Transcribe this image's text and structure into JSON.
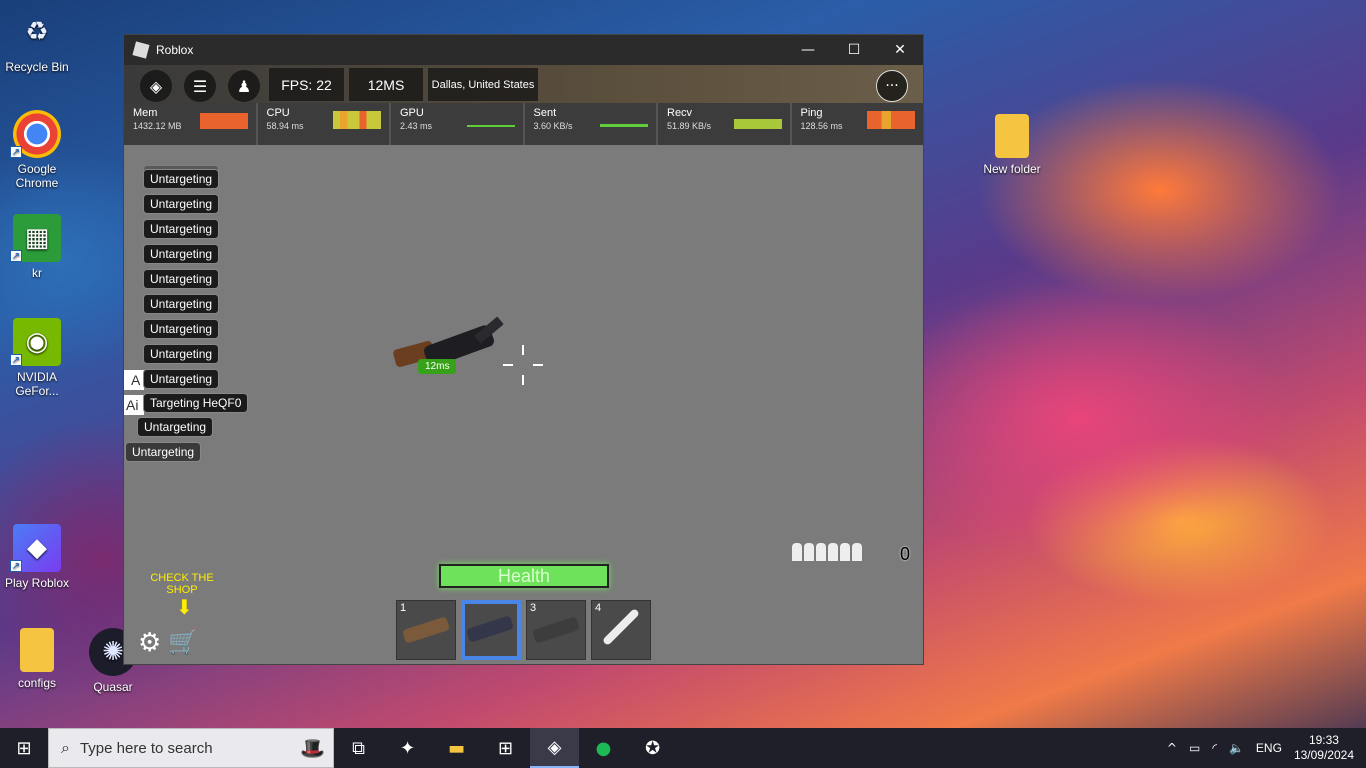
{
  "desktop": {
    "icons": [
      {
        "label": "Recycle Bin"
      },
      {
        "label": "Google Chrome"
      },
      {
        "label": "kr"
      },
      {
        "label": "NVIDIA GeFor..."
      },
      {
        "label": "Play Roblox"
      },
      {
        "label": "configs"
      },
      {
        "label": "Quasar"
      },
      {
        "label": "New folder"
      }
    ]
  },
  "window": {
    "title": "Roblox",
    "minimize": "—",
    "maximize": "☐",
    "close": "✕"
  },
  "topbar": {
    "fps": "FPS: 22",
    "ms": "12MS",
    "location": "Dallas, United States",
    "more": "···"
  },
  "stats": [
    {
      "name": "Mem",
      "value": "1432.12 MB"
    },
    {
      "name": "CPU",
      "value": "58.94 ms"
    },
    {
      "name": "GPU",
      "value": "2.43 ms"
    },
    {
      "name": "Sent",
      "value": "3.60 KB/s"
    },
    {
      "name": "Recv",
      "value": "51.89 KB/s"
    },
    {
      "name": "Ping",
      "value": "128.56 ms"
    }
  ],
  "game": {
    "target_log": [
      "Untargeting",
      "Untargeting",
      "Untargeting",
      "Untargeting",
      "Untargeting",
      "Untargeting",
      "Untargeting",
      "Untargeting",
      "Untargeting",
      "Untargeting",
      "Targeting HeQF0",
      "Untargeting",
      "Untargeting"
    ],
    "side_fragments": [
      "A",
      "Ai"
    ],
    "ping_badge": "12ms",
    "health_label": "Health",
    "ammo_count": "0",
    "shop_label": "CHECK THE SHOP",
    "hotbar": [
      {
        "num": "1",
        "color": "#7a5a3a"
      },
      {
        "num": "",
        "color": "#34374a"
      },
      {
        "num": "3",
        "color": "#3d3d3d"
      },
      {
        "num": "4",
        "color": "#ededed"
      }
    ]
  },
  "taskbar": {
    "search_placeholder": "Type here to search",
    "language": "ENG",
    "time": "19:33",
    "date": "13/09/2024"
  }
}
